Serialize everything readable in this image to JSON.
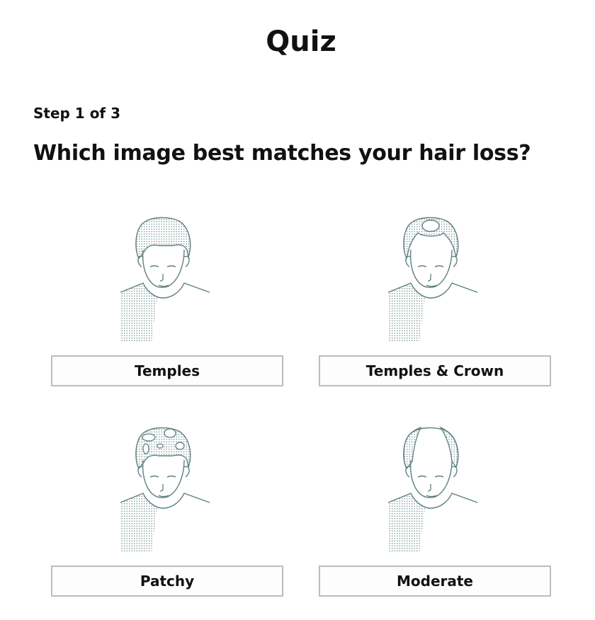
{
  "page": {
    "title": "Quiz",
    "step": "Step 1 of 3",
    "question": "Which image best matches your hair loss?"
  },
  "options": [
    {
      "label": "Temples",
      "illustration": "head-temples-icon"
    },
    {
      "label": "Temples & Crown",
      "illustration": "head-temples-crown-icon"
    },
    {
      "label": "Patchy",
      "illustration": "head-patchy-icon"
    },
    {
      "label": "Moderate",
      "illustration": "head-moderate-icon"
    }
  ],
  "colors": {
    "line": "#5f7f7f",
    "button_border": "#bdbdbd",
    "text": "#111111"
  }
}
